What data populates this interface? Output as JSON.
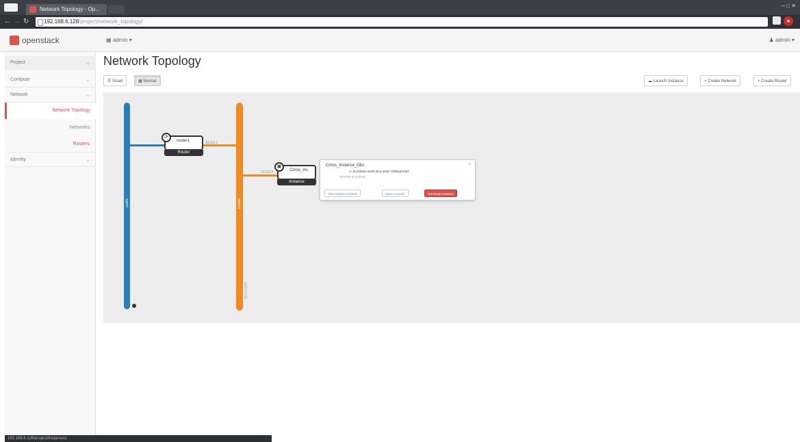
{
  "browser": {
    "tab_title": "Network Topology - Op...",
    "url_host": "192.168.6.128",
    "url_path": "/project/network_topology/"
  },
  "header": {
    "logo_text": "openstack",
    "project_menu": "admin ▾",
    "user_menu": "admin ▾"
  },
  "sidebar": {
    "items": [
      {
        "label": "Project"
      },
      {
        "label": "Compute"
      },
      {
        "label": "Network"
      },
      {
        "label": "Network Topology"
      },
      {
        "label": "Networks"
      },
      {
        "label": "Routers"
      },
      {
        "label": "Identity"
      }
    ]
  },
  "page": {
    "title": "Network Topology"
  },
  "view_toggle": {
    "small": "Small",
    "normal": "Normal"
  },
  "actions": {
    "launch_instance": "Launch Instance",
    "create_network": "+ Create Network",
    "create_router": "+ Create Router"
  },
  "topology": {
    "networks": [
      {
        "name": "public",
        "color": "#2980b9"
      },
      {
        "name": "private",
        "color": "#f0891f",
        "cidr": "10.0.0.0/24"
      }
    ],
    "router": {
      "name": "router1",
      "type": "Router",
      "port_label": "10.0.0.1"
    },
    "instance": {
      "name": "Cirros_ins",
      "type": "Instance",
      "port_label": "10.0.0.3"
    }
  },
  "popup": {
    "title": "Cirros_Instance_Obs",
    "id_label": "ID",
    "id_value": "bc20906e-5ed0-4fca-a93d-72f99a4f1083",
    "status_label": "STATUS",
    "status_value": "ACTIVE",
    "btn_view": "View Instance Details",
    "btn_console": "Open Console",
    "btn_terminate": "Terminate Instance"
  },
  "statusbar": {
    "text": "192.168.6.128/project/instances/"
  }
}
